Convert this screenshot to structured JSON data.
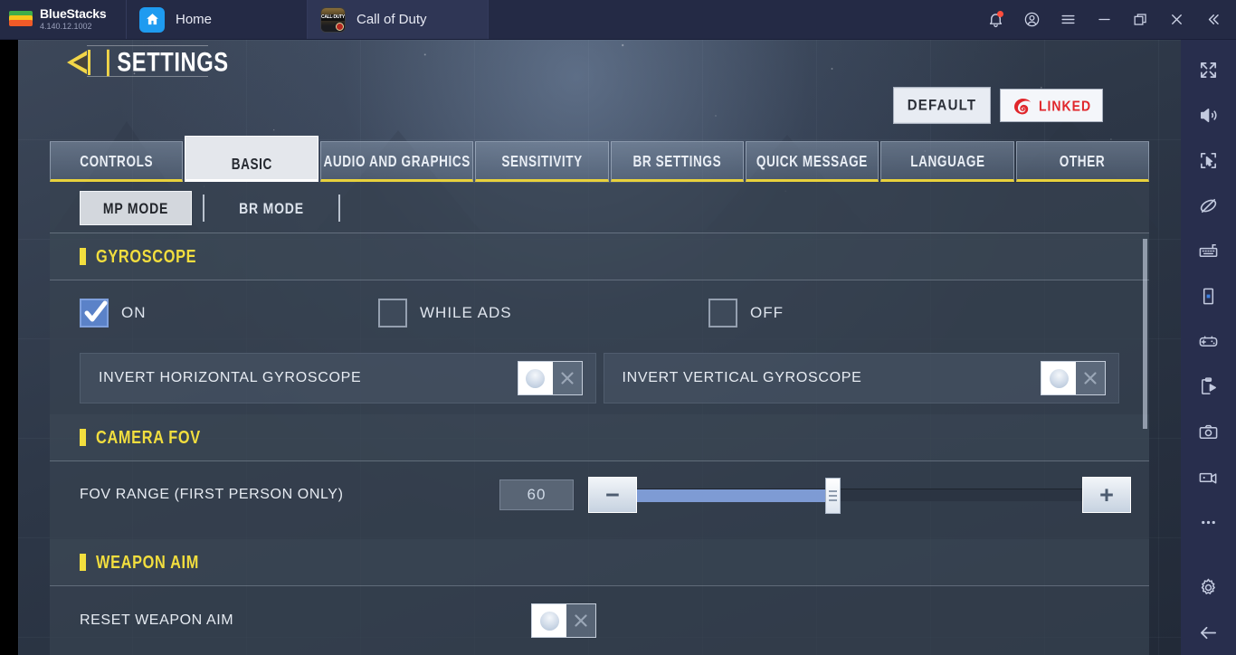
{
  "titlebar": {
    "brand_name": "BlueStacks",
    "version": "4.140.12.1002",
    "tabs": [
      {
        "label": "Home",
        "icon": "home-icon",
        "active": false
      },
      {
        "label": "Call of Duty",
        "icon": "cod-app-icon",
        "active": true
      }
    ],
    "actions": [
      {
        "name": "notifications-icon",
        "label": "Notifications",
        "badge": true
      },
      {
        "name": "account-icon",
        "label": "Account"
      },
      {
        "name": "menu-icon",
        "label": "Menu"
      },
      {
        "name": "minimize-icon",
        "label": "Minimize"
      },
      {
        "name": "restore-icon",
        "label": "Restore"
      },
      {
        "name": "close-icon",
        "label": "Close"
      },
      {
        "name": "collapse-sidebar-icon",
        "label": "Collapse"
      }
    ]
  },
  "sidebar": {
    "items": [
      {
        "name": "fullscreen-icon",
        "label": "Full screen"
      },
      {
        "name": "volume-icon",
        "label": "Volume"
      },
      {
        "name": "cursor-select-icon",
        "label": "Mouse control"
      },
      {
        "name": "eye-slash-icon",
        "label": "Hide controls"
      },
      {
        "name": "keyboard-icon",
        "label": "Game controls"
      },
      {
        "name": "device-rotate-icon",
        "label": "Rotate"
      },
      {
        "name": "gamepad-icon",
        "label": "Gamepad"
      },
      {
        "name": "script-play-icon",
        "label": "Macro"
      },
      {
        "name": "camera-icon",
        "label": "Screenshot"
      },
      {
        "name": "video-record-icon",
        "label": "Record"
      },
      {
        "name": "more-icon",
        "label": "More"
      },
      {
        "name": "gear-icon",
        "label": "Settings"
      },
      {
        "name": "back-arrow-icon",
        "label": "Back"
      }
    ]
  },
  "game": {
    "header": {
      "title": "SETTINGS",
      "back_icon": "back-triangle-icon"
    },
    "top_buttons": {
      "default_label": "DEFAULT",
      "linked_label": "LINKED",
      "linked_icon": "garena-logo-icon",
      "linked_color": "#e0262b"
    },
    "tabs": [
      {
        "label": "CONTROLS",
        "active": false
      },
      {
        "label": "BASIC",
        "active": true
      },
      {
        "label": "AUDIO AND GRAPHICS",
        "active": false
      },
      {
        "label": "SENSITIVITY",
        "active": false
      },
      {
        "label": "BR SETTINGS",
        "active": false
      },
      {
        "label": "QUICK MESSAGE",
        "active": false
      },
      {
        "label": "LANGUAGE",
        "active": false
      },
      {
        "label": "OTHER",
        "active": false
      }
    ],
    "modes": [
      {
        "label": "MP MODE",
        "active": true
      },
      {
        "label": "BR MODE",
        "active": false
      }
    ],
    "sections": [
      {
        "title": "GYROSCOPE",
        "checkboxes": [
          {
            "label": "ON",
            "checked": true
          },
          {
            "label": "WHILE ADS",
            "checked": false
          },
          {
            "label": "OFF",
            "checked": false
          }
        ],
        "toggles": [
          {
            "label": "INVERT HORIZONTAL GYROSCOPE",
            "state": "off"
          },
          {
            "label": "INVERT VERTICAL GYROSCOPE",
            "state": "off"
          }
        ]
      },
      {
        "title": "CAMERA FOV",
        "slider": {
          "label": "FOV RANGE (FIRST PERSON ONLY)",
          "value": "60",
          "minus_label": "−",
          "plus_label": "+",
          "fill_percent": 44
        }
      },
      {
        "title": "WEAPON AIM",
        "toggle": {
          "label": "RESET WEAPON AIM",
          "state": "off"
        }
      }
    ],
    "accent_yellow": "#f2de3e",
    "accent_blue": "#7e9bd4"
  }
}
